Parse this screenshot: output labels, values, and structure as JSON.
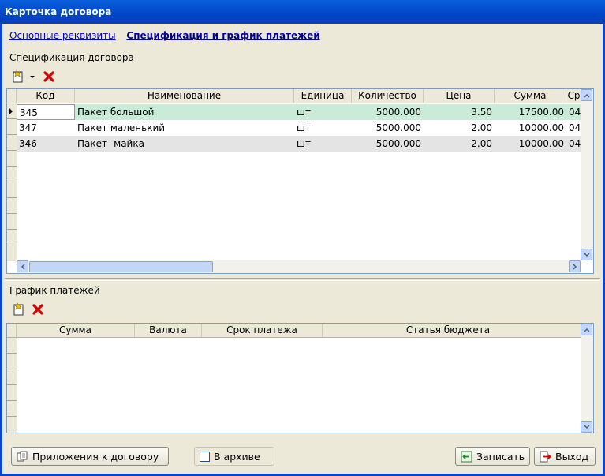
{
  "window": {
    "title": "Карточка договора"
  },
  "tabs": [
    {
      "label": "Основные реквизиты"
    },
    {
      "label": "Спецификация и график платежей"
    }
  ],
  "specification": {
    "title": "Спецификация договора",
    "columns": [
      "Код",
      "Наименование",
      "Единица",
      "Количество",
      "Цена",
      "Сумма",
      "Ср"
    ],
    "rows": [
      {
        "code": "345",
        "name": "Пакет большой",
        "unit": "шт",
        "qty": "5000.000",
        "price": "3.50",
        "sum": "17500.00",
        "extra": "04"
      },
      {
        "code": "347",
        "name": "Пакет маленький",
        "unit": "шт",
        "qty": "5000.000",
        "price": "2.00",
        "sum": "10000.00",
        "extra": "04"
      },
      {
        "code": "346",
        "name": "Пакет- майка",
        "unit": "шт",
        "qty": "5000.000",
        "price": "2.00",
        "sum": "10000.00",
        "extra": "04"
      }
    ]
  },
  "payments": {
    "title": "График платежей",
    "columns": [
      "Сумма",
      "Валюта",
      "Срок платежа",
      "Статья бюджета"
    ]
  },
  "buttons": {
    "attachments": "Приложения к договору",
    "archive": "В архиве",
    "save": "Записать",
    "exit": "Выход"
  },
  "colors": {
    "selected_row": "#c8ecd8",
    "alt_row": "#e4e4e4",
    "title_bar": "#0a5fdc"
  }
}
